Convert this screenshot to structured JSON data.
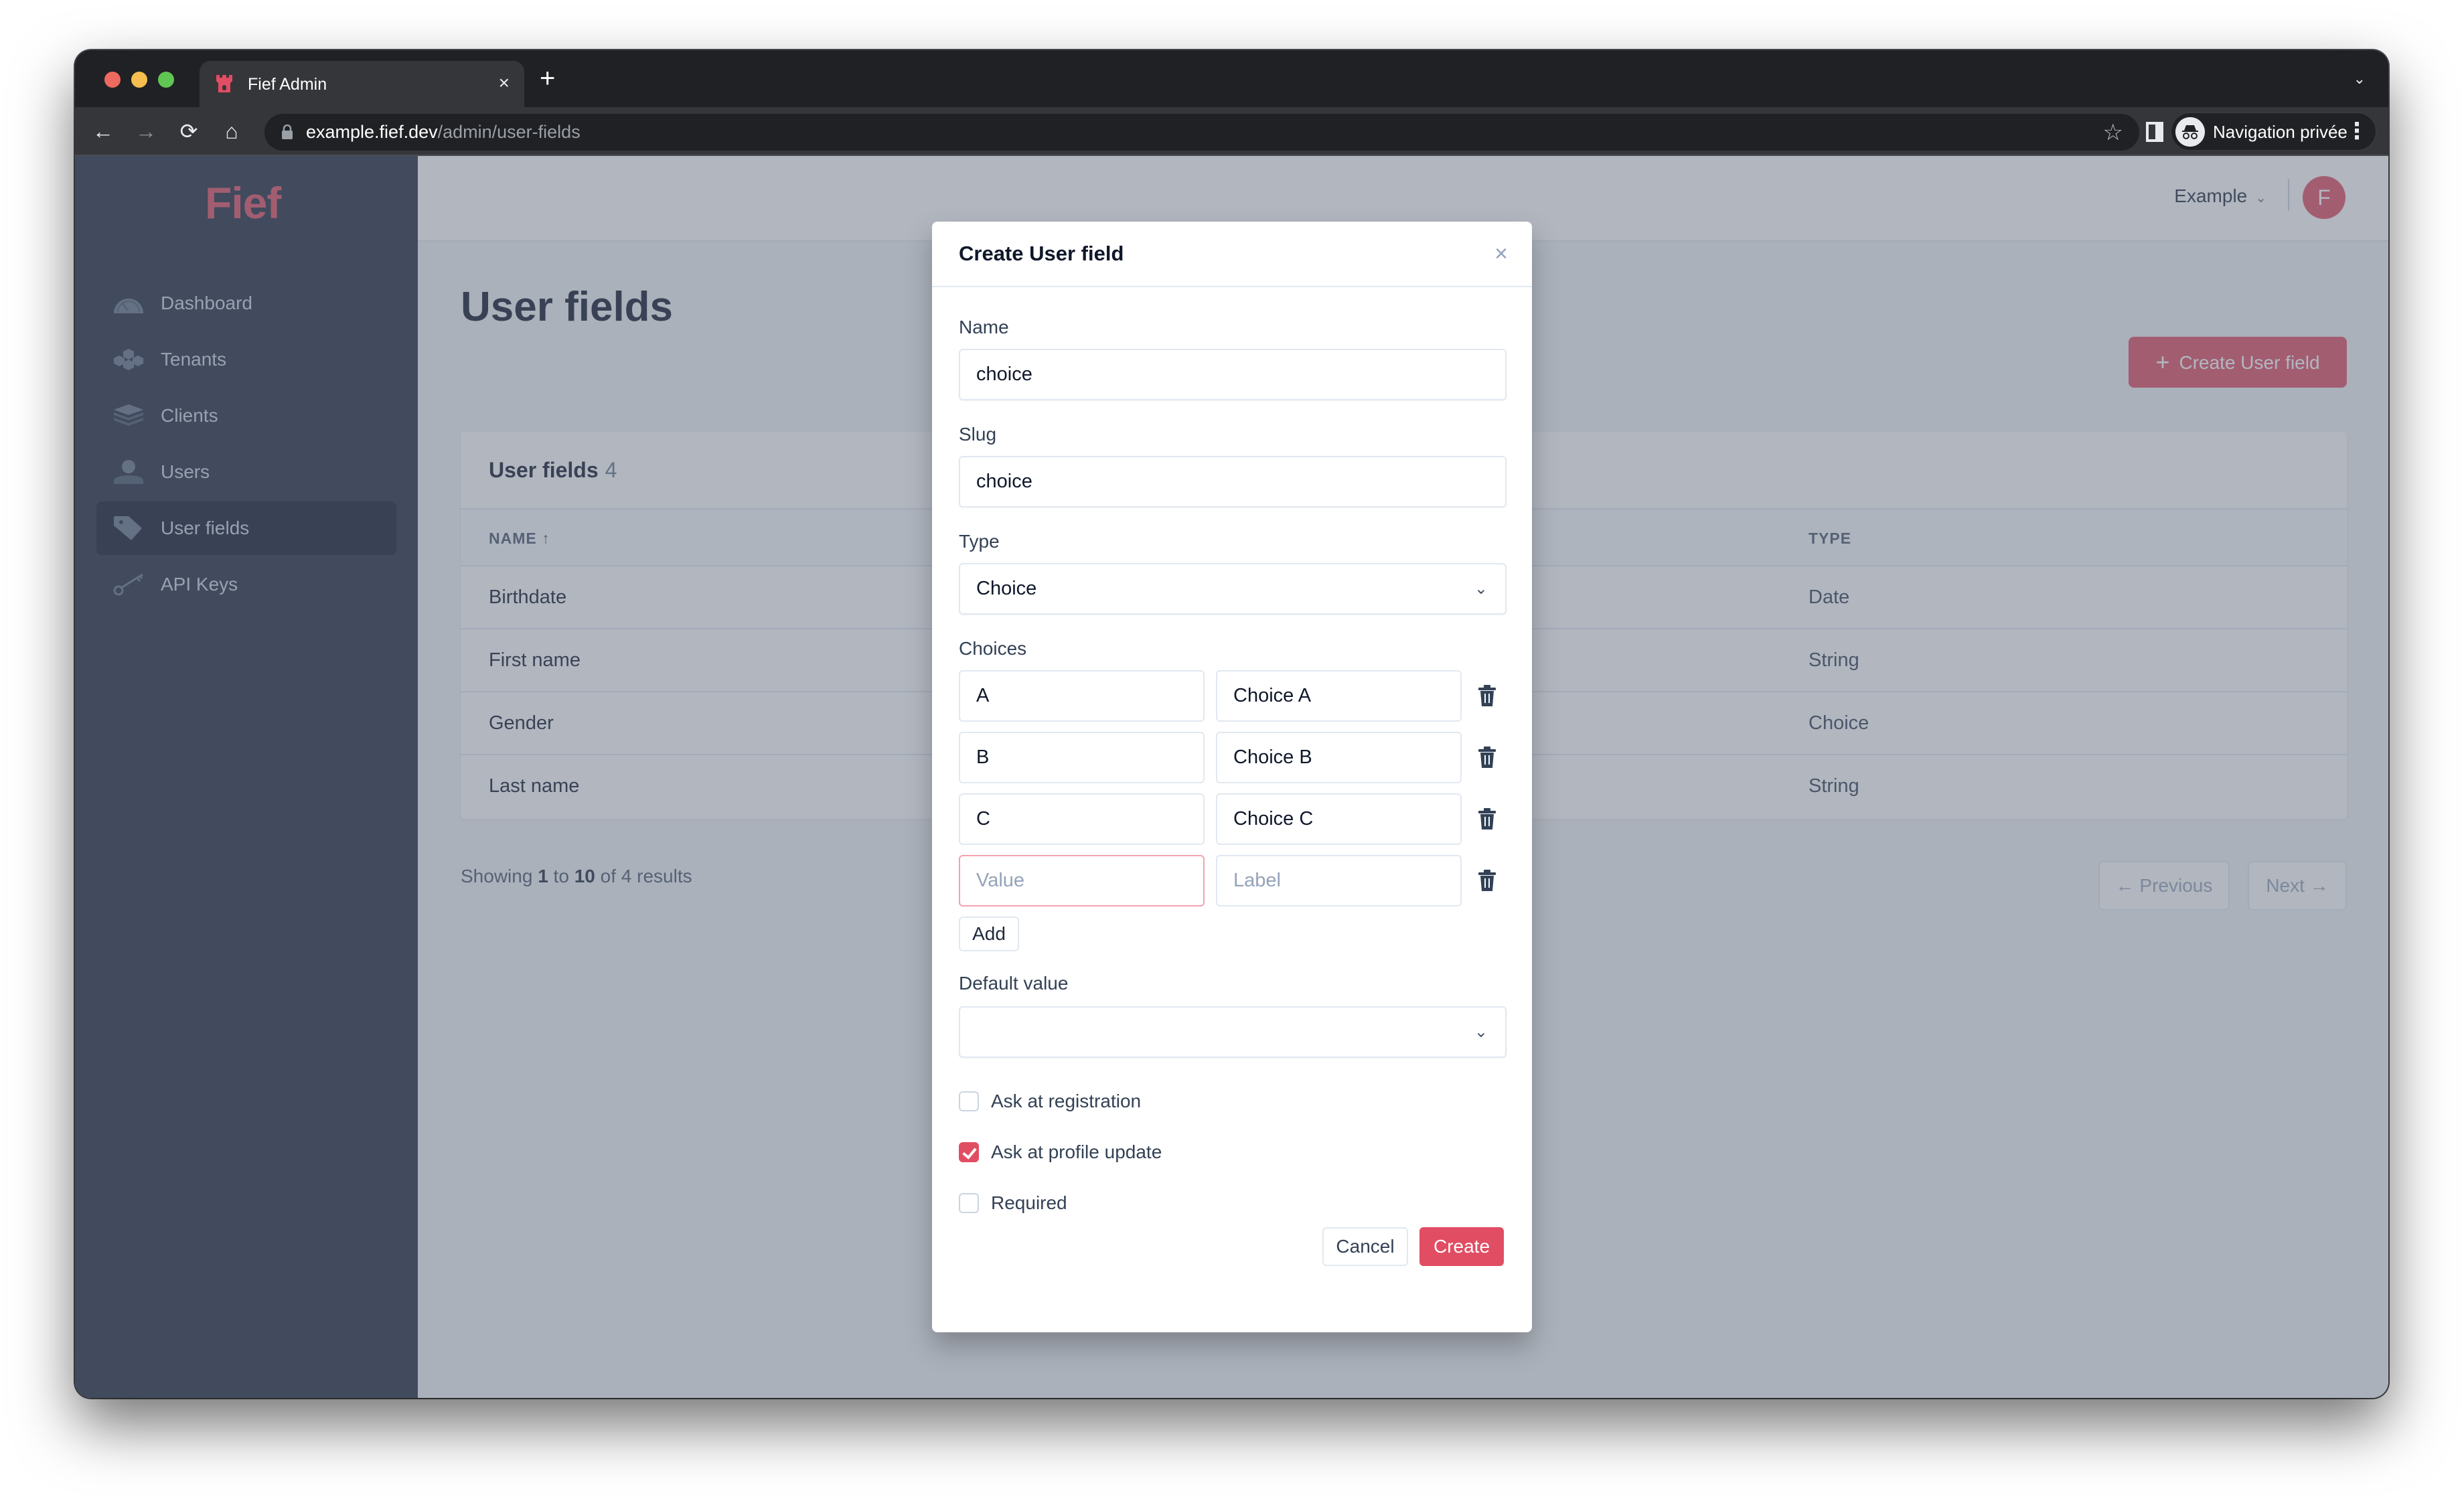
{
  "browser": {
    "tab_title": "Fief Admin",
    "tab_close": "×",
    "new_tab": "+",
    "url_host": "example.fief.dev",
    "url_path": "/admin/user-fields",
    "incognito_label": "Navigation privée",
    "icons": {
      "back": "←",
      "forward": "→",
      "reload": "⟳",
      "home": "⌂",
      "star": "☆",
      "kebab": "⋮",
      "tab_dropdown": "⌄"
    }
  },
  "app": {
    "logo": "Fief",
    "brand_color": "#e14d63",
    "sidebar": {
      "items": [
        {
          "label": "Dashboard",
          "icon": "gauge-icon",
          "active": false
        },
        {
          "label": "Tenants",
          "icon": "cubes-icon",
          "active": false
        },
        {
          "label": "Clients",
          "icon": "layers-icon",
          "active": false
        },
        {
          "label": "Users",
          "icon": "user-icon",
          "active": false
        },
        {
          "label": "User fields",
          "icon": "tag-icon",
          "active": true
        },
        {
          "label": "API Keys",
          "icon": "key-icon",
          "active": false
        }
      ]
    },
    "topbar": {
      "org": "Example",
      "avatar_initial": "F"
    },
    "page": {
      "title": "User fields",
      "create_button": "Create User field",
      "create_icon": "+"
    },
    "table": {
      "title": "User fields",
      "count": "4",
      "columns": [
        "NAME ↑",
        "TYPE"
      ],
      "rows": [
        {
          "name": "Birthdate",
          "type": "Date"
        },
        {
          "name": "First name",
          "type": "String"
        },
        {
          "name": "Gender",
          "type": "Choice"
        },
        {
          "name": "Last name",
          "type": "String"
        }
      ]
    },
    "pagination": {
      "showing": "Showing",
      "from": "1",
      "to_word": "to",
      "to": "10",
      "of_word": "of",
      "total": "4",
      "results_word": "results",
      "previous": "← Previous",
      "next": "Next →"
    }
  },
  "modal": {
    "title": "Create User field",
    "close": "×",
    "name_label": "Name",
    "name_value": "choice",
    "slug_label": "Slug",
    "slug_value": "choice",
    "type_label": "Type",
    "type_value": "Choice",
    "choices_label": "Choices",
    "choices": [
      {
        "value": "A",
        "label": "Choice A"
      },
      {
        "value": "B",
        "label": "Choice B"
      },
      {
        "value": "C",
        "label": "Choice C"
      }
    ],
    "new_choice_placeholder_value": "Value",
    "new_choice_placeholder_label": "Label",
    "add_button": "Add",
    "default_label": "Default value",
    "default_value": "",
    "checkboxes": [
      {
        "label": "Ask at registration",
        "checked": false
      },
      {
        "label": "Ask at profile update",
        "checked": true
      },
      {
        "label": "Required",
        "checked": false
      }
    ],
    "cancel": "Cancel",
    "create": "Create"
  }
}
